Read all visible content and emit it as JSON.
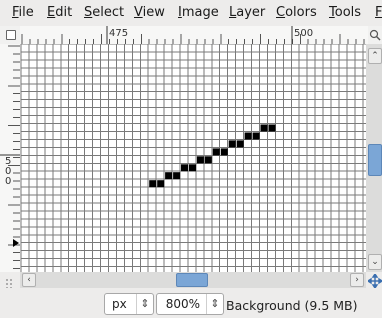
{
  "menu": [
    {
      "label": "File",
      "mnemonic": "F",
      "rest": "ile"
    },
    {
      "label": "Edit",
      "mnemonic": "E",
      "rest": "dit"
    },
    {
      "label": "Select",
      "mnemonic": "S",
      "rest": "elect"
    },
    {
      "label": "View",
      "mnemonic": "V",
      "rest": "iew"
    },
    {
      "label": "Image",
      "mnemonic": "I",
      "rest": "mage"
    },
    {
      "label": "Layer",
      "mnemonic": "L",
      "rest": "ayer"
    },
    {
      "label": "Colors",
      "mnemonic": "C",
      "rest": "olors"
    },
    {
      "label": "Tools",
      "mnemonic": "T",
      "rest": "ools"
    },
    {
      "label": "F",
      "mnemonic": "F",
      "rest": ""
    }
  ],
  "ruler": {
    "h_labels": [
      "475",
      "500"
    ],
    "v_label": "500"
  },
  "status": {
    "unit": "px",
    "zoom": "800",
    "zoom_unit": "%",
    "layer_info": "Background (9.5 MB)"
  },
  "canvas": {
    "grid_color": "#7a7a7a",
    "pixel_color": "#000000",
    "background_color": "#ffffff"
  },
  "scroll": {
    "h_position": 0.47,
    "v_position": 0.48
  },
  "colors": {
    "thumb": "#7ba6d6",
    "window_bg": "#edeceb"
  }
}
